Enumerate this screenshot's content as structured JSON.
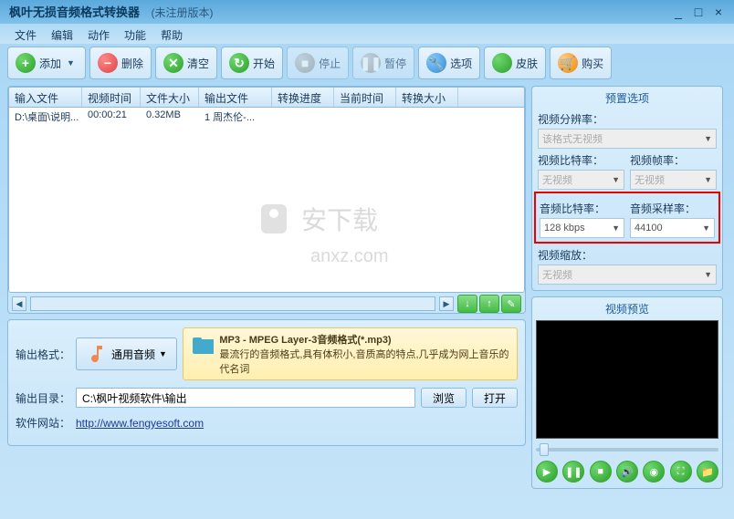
{
  "title": "枫叶无损音频格式转换器",
  "subtitle": "(未注册版本)",
  "menu": [
    "文件",
    "编辑",
    "动作",
    "功能",
    "帮助"
  ],
  "toolbar": {
    "add": "添加",
    "delete": "删除",
    "clear": "清空",
    "start": "开始",
    "stop": "停止",
    "pause": "暂停",
    "options": "选项",
    "skin": "皮肤",
    "buy": "购买"
  },
  "table": {
    "headers": [
      "输入文件",
      "视频时间",
      "文件大小",
      "输出文件",
      "转换进度",
      "当前时间",
      "转换大小"
    ],
    "rows": [
      {
        "input": "D:\\桌面\\说明...",
        "time": "00:00:21",
        "size": "0.32MB",
        "output": "1 周杰伦-...",
        "progress": "",
        "curtime": "",
        "convsize": ""
      }
    ]
  },
  "output": {
    "format_label": "输出格式：",
    "format_btn": "通用音频",
    "format_title": "MP3 - MPEG Layer-3音频格式(*.mp3)",
    "format_desc": "最流行的音频格式,具有体积小,音质高的特点,几乎成为网上音乐的代名词",
    "dir_label": "输出目录：",
    "dir_value": "C:\\枫叶视频软件\\输出",
    "browse": "浏览",
    "open": "打开",
    "site_label": "软件网站：",
    "site_url": "http://www.fengyesoft.com"
  },
  "preset": {
    "title": "预置选项",
    "video_res_label": "视频分辨率：",
    "video_res_value": "该格式无视频",
    "video_bitrate_label": "视频比特率：",
    "video_bitrate_value": "无视频",
    "video_fps_label": "视频帧率：",
    "video_fps_value": "无视频",
    "audio_bitrate_label": "音频比特率：",
    "audio_bitrate_value": "128 kbps",
    "audio_sample_label": "音频采样率：",
    "audio_sample_value": "44100",
    "video_zoom_label": "视频缩放：",
    "video_zoom_value": "无视频"
  },
  "preview": {
    "title": "视频预览"
  },
  "watermark": {
    "text1": "安下载",
    "text2": "anxz.com"
  }
}
